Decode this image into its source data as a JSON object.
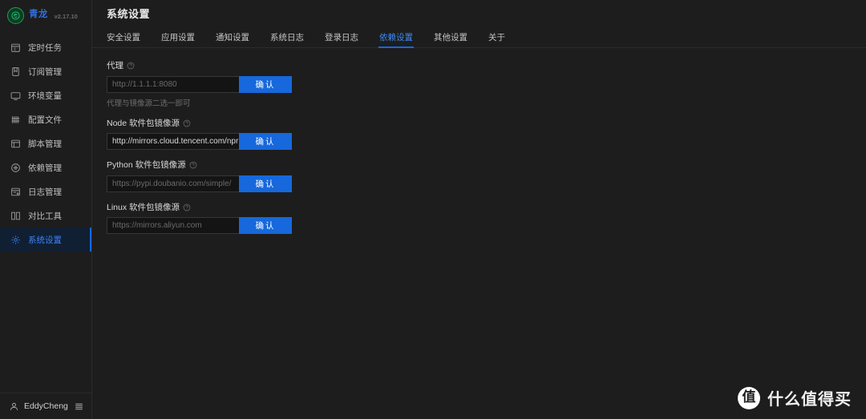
{
  "app": {
    "brand_name": "青龙",
    "version": "v2.17.10",
    "accent_color": "#1668dc",
    "logo_color": "#17a05c",
    "bg_color": "#1d1d1d"
  },
  "sidebar": {
    "items": [
      {
        "label": "定时任务",
        "icon": "schedule-icon",
        "active": false
      },
      {
        "label": "订阅管理",
        "icon": "subscription-icon",
        "active": false
      },
      {
        "label": "环境变量",
        "icon": "monitor-icon",
        "active": false
      },
      {
        "label": "配置文件",
        "icon": "config-file-icon",
        "active": false
      },
      {
        "label": "脚本管理",
        "icon": "script-icon",
        "active": false
      },
      {
        "label": "依赖管理",
        "icon": "dependency-icon",
        "active": false
      },
      {
        "label": "日志管理",
        "icon": "log-icon",
        "active": false
      },
      {
        "label": "对比工具",
        "icon": "diff-tool-icon",
        "active": false
      },
      {
        "label": "系统设置",
        "icon": "gear-icon",
        "active": true
      }
    ],
    "footer": {
      "username": "EddyCheng",
      "user_icon": "user-icon",
      "menu_icon": "list-menu-icon"
    }
  },
  "header": {
    "title": "系统设置"
  },
  "tabs": [
    {
      "label": "安全设置",
      "active": false
    },
    {
      "label": "应用设置",
      "active": false
    },
    {
      "label": "通知设置",
      "active": false
    },
    {
      "label": "系统日志",
      "active": false
    },
    {
      "label": "登录日志",
      "active": false
    },
    {
      "label": "依赖设置",
      "active": true
    },
    {
      "label": "其他设置",
      "active": false
    },
    {
      "label": "关于",
      "active": false
    }
  ],
  "form": {
    "confirm_label": "确认",
    "help_icon": "question-circle-icon",
    "fields": [
      {
        "label": "代理",
        "value": "",
        "placeholder": "http://1.1.1.1:8080",
        "hint": "代理与镜像源二选一即可"
      },
      {
        "label": "Node 软件包镜像源",
        "value": "http://mirrors.cloud.tencent.com/npr",
        "placeholder": "",
        "hint": ""
      },
      {
        "label": "Python 软件包镜像源",
        "value": "",
        "placeholder": "https://pypi.doubanio.com/simple/",
        "hint": ""
      },
      {
        "label": "Linux 软件包镜像源",
        "value": "",
        "placeholder": "https://mirrors.aliyun.com",
        "hint": ""
      }
    ]
  },
  "watermark": {
    "logo_char": "值",
    "text": "什么值得买"
  }
}
